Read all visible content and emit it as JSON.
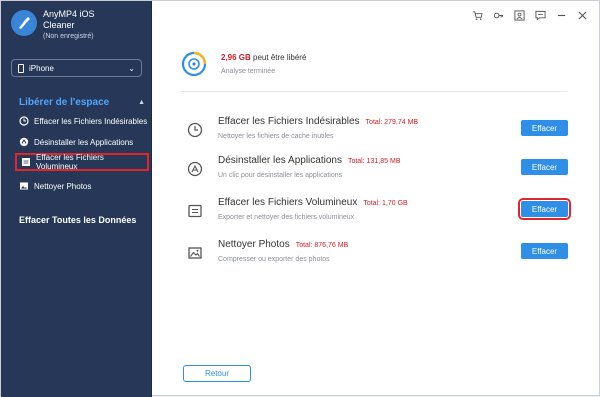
{
  "app": {
    "name": "AnyMP4 iOS",
    "name2": "Cleaner",
    "status": "(Non enregistré)"
  },
  "device": {
    "selected": "iPhone"
  },
  "sidebar": {
    "section_title": "Libérer de l'espace",
    "items": [
      {
        "label": "Effacer les Fichiers Indésirables",
        "icon": "clock-icon"
      },
      {
        "label": "Désinstaller les Applications",
        "icon": "apps-icon"
      },
      {
        "label": "Effacer les Fichiers Volumineux",
        "icon": "document-icon"
      },
      {
        "label": "Nettoyer Photos",
        "icon": "photo-icon"
      }
    ],
    "clean_all": "Effacer Toutes les Données"
  },
  "titlebar": {
    "icons": [
      "cart-icon",
      "key-icon",
      "user-icon",
      "feedback-icon",
      "minimize-icon",
      "close-icon"
    ]
  },
  "summary": {
    "freeable": "2,96 GB",
    "freeable_text": "peut être libéré",
    "status": "Analyse terminée"
  },
  "rows": [
    {
      "title": "Effacer les Fichiers Indésirables",
      "total": "Total: 279,74 MB",
      "desc": "Nettoyer les fichiers de cache inutiles",
      "button": "Effacer"
    },
    {
      "title": "Désinstaller les Applications",
      "total": "Total: 131,85 MB",
      "desc": "Un clic pour désinstaller les applications",
      "button": "Effacer"
    },
    {
      "title": "Effacer les Fichiers Volumineux",
      "total": "Total: 1,70 GB",
      "desc": "Exporter et nettoyer des fichiers volumineux",
      "button": "Effacer"
    },
    {
      "title": "Nettoyer Photos",
      "total": "Total: 876,76 MB",
      "desc": "Compresser ou exporter des photos",
      "button": "Effacer"
    }
  ],
  "back_button": "Retour",
  "colors": {
    "sidebar": "#263757",
    "accent": "#2f8ee6",
    "highlight": "#e0252c",
    "size_red": "#d12027",
    "section_blue": "#53a6ff"
  }
}
